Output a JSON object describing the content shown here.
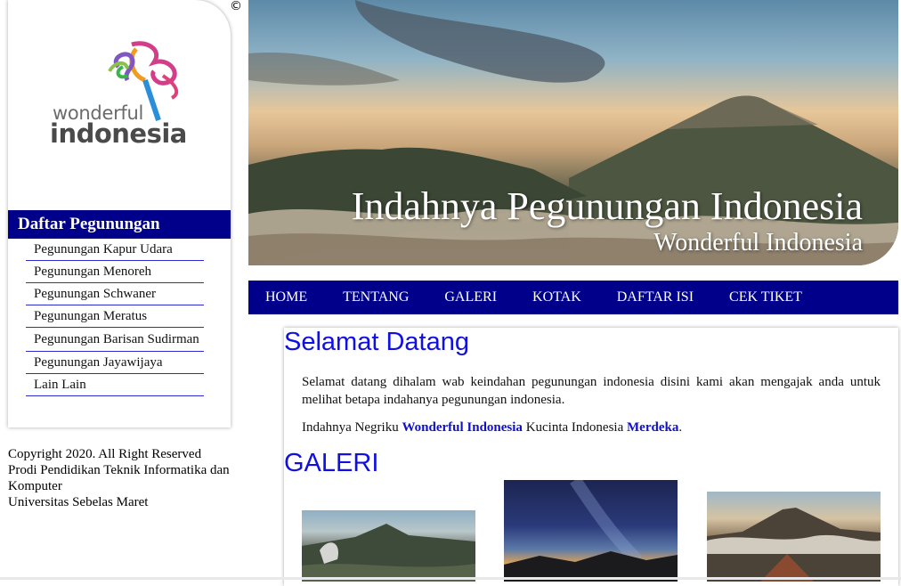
{
  "sidebar": {
    "logo_text_line1": "wonderful",
    "logo_text_line2": "indonesia",
    "heading": "Daftar Pegunungan",
    "items": [
      {
        "label": "Pegunungan Kapur Udara"
      },
      {
        "label": "Pegunungan Menoreh"
      },
      {
        "label": "Pegunungan Schwaner"
      },
      {
        "label": "Pegunungan Meratus"
      },
      {
        "label": "Pegunungan Barisan Sudirman"
      },
      {
        "label": "Pegunungan Jayawijaya"
      },
      {
        "label": "Lain Lain"
      }
    ]
  },
  "copyright_symbol": "©",
  "footer": {
    "line1": "Copyright 2020. All Right Reserved",
    "line2": "Prodi Pendidikan Teknik Informatika dan Komputer",
    "line3": "Universitas Sebelas Maret"
  },
  "banner": {
    "title": "Indahnya Pegunungan Indonesia",
    "subtitle": "Wonderful Indonesia"
  },
  "nav": [
    {
      "label": "HOME"
    },
    {
      "label": "TENTANG"
    },
    {
      "label": "GALERI"
    },
    {
      "label": "KOTAK"
    },
    {
      "label": "DAFTAR ISI"
    },
    {
      "label": "CEK TIKET"
    }
  ],
  "main": {
    "welcome_heading": "Selamat Datang",
    "welcome_text": "Selamat datang dihalam wab keindahan pegunungan indonesia disini kami akan mengajak anda untuk melihat betapa indahanya pegunungan indonesia.",
    "tagline_prefix": "Indahnya Negriku ",
    "tagline_bold1": "Wonderful Indonesia",
    "tagline_middle": " Kucinta Indonesia ",
    "tagline_bold2": "Merdeka",
    "tagline_suffix": ".",
    "gallery_heading": "GALERI"
  },
  "colors": {
    "nav_bg": "#00008b",
    "heading_blue": "#1010e0",
    "link_blue": "#1010c8"
  }
}
